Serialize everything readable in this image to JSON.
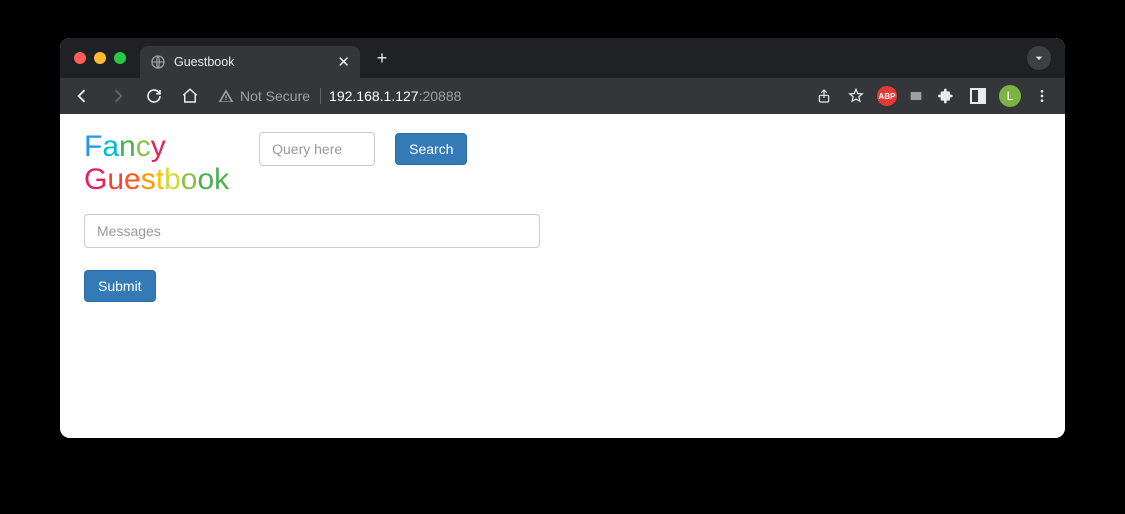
{
  "window": {
    "tab_title": "Guestbook",
    "new_tab_label": "+"
  },
  "toolbar": {
    "not_secure": "Not Secure",
    "url_host": "192.168.1.127",
    "url_port": ":20888",
    "profile_initial": "L",
    "abp_label": "ABP"
  },
  "page": {
    "title_line1": "Fancy",
    "title_line2": "Guestbook",
    "query_placeholder": "Query here",
    "search_button": "Search",
    "messages_placeholder": "Messages",
    "submit_button": "Submit"
  }
}
